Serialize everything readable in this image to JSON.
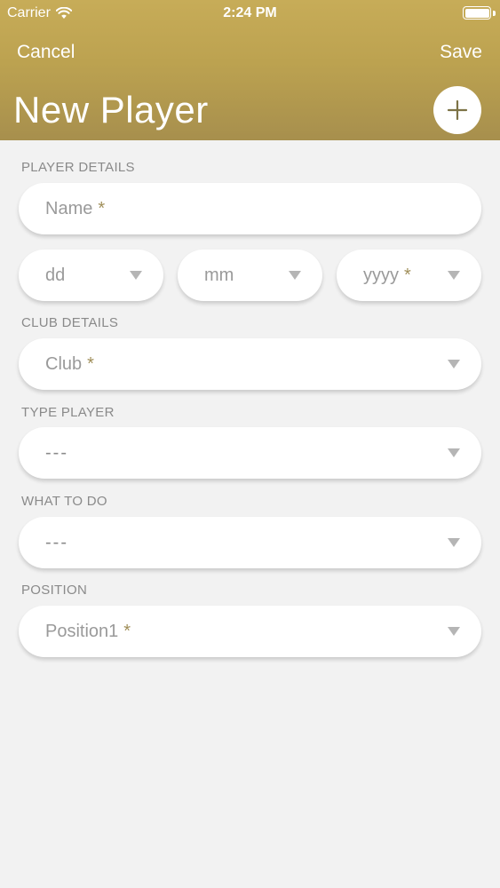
{
  "status_bar": {
    "carrier": "Carrier",
    "time": "2:24 PM"
  },
  "nav": {
    "cancel_label": "Cancel",
    "save_label": "Save",
    "title": "New Player",
    "add_icon": "plus-icon"
  },
  "sections": {
    "player_details": "PLAYER DETAILS",
    "club_details": "CLUB DETAILS",
    "type_player": "TYPE PLAYER",
    "what_to_do": "WHAT TO DO",
    "position": "POSITION"
  },
  "fields": {
    "name": {
      "placeholder": "Name",
      "required_mark": "*"
    },
    "dob_day": {
      "placeholder": "dd"
    },
    "dob_month": {
      "placeholder": "mm"
    },
    "dob_year": {
      "placeholder": "yyyy",
      "required_mark": "*"
    },
    "club": {
      "placeholder": "Club",
      "required_mark": "*"
    },
    "type_player": {
      "value": "---"
    },
    "what_to_do": {
      "value": "---"
    },
    "position": {
      "placeholder": "Position1",
      "required_mark": "*"
    }
  },
  "colors": {
    "header_top": "#c7ac58",
    "header_bottom": "#a78f4d",
    "background": "#f2f2f2",
    "accent": "#a08f5a"
  }
}
